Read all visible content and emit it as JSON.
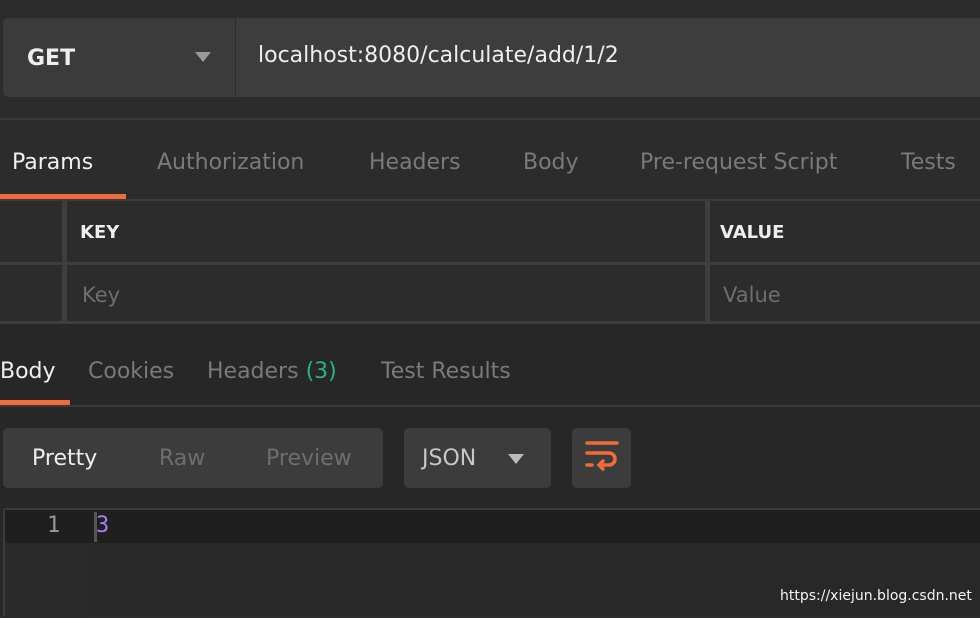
{
  "request": {
    "method": "GET",
    "url": "localhost:8080/calculate/add/1/2"
  },
  "request_tabs": [
    {
      "label": "Params",
      "active": true
    },
    {
      "label": "Authorization"
    },
    {
      "label": "Headers"
    },
    {
      "label": "Body"
    },
    {
      "label": "Pre-request Script"
    },
    {
      "label": "Tests"
    }
  ],
  "params_table": {
    "headers": {
      "key": "KEY",
      "value": "VALUE"
    },
    "placeholders": {
      "key": "Key",
      "value": "Value"
    }
  },
  "response_tabs": [
    {
      "label": "Body",
      "active": true
    },
    {
      "label": "Cookies"
    },
    {
      "label": "Headers",
      "count": "(3)"
    },
    {
      "label": "Test Results"
    }
  ],
  "view_modes": [
    "Pretty",
    "Raw",
    "Preview"
  ],
  "format": "JSON",
  "wrap_icon": "wrap-lines-icon",
  "editor": {
    "line_number": "1",
    "content": "3"
  },
  "watermark": "https://xiejun.blog.csdn.net",
  "colors": {
    "accent": "#f26b3a",
    "count": "#26b47f",
    "number": "#a97cf0"
  }
}
